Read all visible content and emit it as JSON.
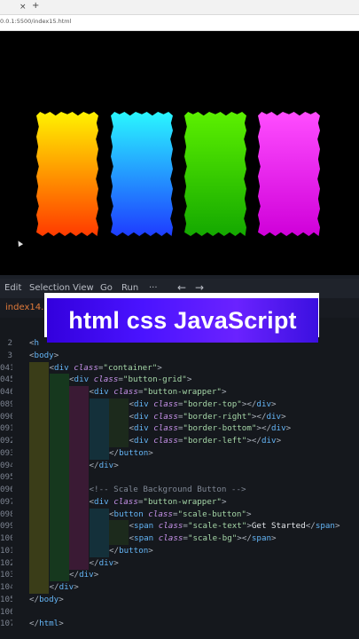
{
  "browser": {
    "tab_close": "×",
    "tab_new": "+",
    "address": "0.0.1:5500/index15.html"
  },
  "preview": {
    "panels": [
      {
        "name": "yellow-orange",
        "from": "#fff200",
        "to": "#ff3a00"
      },
      {
        "name": "cyan-blue",
        "from": "#2af7ff",
        "to": "#1e3cff"
      },
      {
        "name": "green",
        "from": "#5cf000",
        "to": "#14a800"
      },
      {
        "name": "magenta",
        "from": "#ff4dff",
        "to": "#cf00d9"
      }
    ]
  },
  "menu": {
    "items": [
      "Edit",
      "Selection",
      "View",
      "Go",
      "Run",
      "···"
    ],
    "back": "←",
    "forward": "→"
  },
  "editor": {
    "active_tab": "index14.h",
    "lines": [
      {
        "n": "2",
        "guides": 0,
        "tokens": [
          [
            "p",
            "<"
          ],
          [
            "t",
            "h"
          ]
        ]
      },
      {
        "n": "3",
        "guides": 0,
        "tokens": [
          [
            "p",
            "<"
          ],
          [
            "t",
            "body"
          ],
          [
            "p",
            ">"
          ]
        ]
      },
      {
        "n": "041",
        "guides": 1,
        "tokens": [
          [
            "p",
            "<"
          ],
          [
            "t",
            "div"
          ],
          [
            "x",
            " "
          ],
          [
            "a",
            "class"
          ],
          [
            "p",
            "="
          ],
          [
            "s",
            "\"container\""
          ],
          [
            "p",
            ">"
          ]
        ]
      },
      {
        "n": "045",
        "guides": 2,
        "tokens": [
          [
            "p",
            "<"
          ],
          [
            "t",
            "div"
          ],
          [
            "x",
            " "
          ],
          [
            "a",
            "class"
          ],
          [
            "p",
            "="
          ],
          [
            "s",
            "\"button-grid\""
          ],
          [
            "p",
            ">"
          ]
        ]
      },
      {
        "n": "046",
        "guides": 3,
        "tokens": [
          [
            "p",
            "<"
          ],
          [
            "t",
            "div"
          ],
          [
            "x",
            " "
          ],
          [
            "a",
            "class"
          ],
          [
            "p",
            "="
          ],
          [
            "s",
            "\"button-wrapper\""
          ],
          [
            "p",
            ">"
          ]
        ]
      },
      {
        "n": "089",
        "guides": 5,
        "tokens": [
          [
            "p",
            "<"
          ],
          [
            "t",
            "div"
          ],
          [
            "x",
            " "
          ],
          [
            "a",
            "class"
          ],
          [
            "p",
            "="
          ],
          [
            "s",
            "\"border-top\""
          ],
          [
            "p",
            "></"
          ],
          [
            "t",
            "div"
          ],
          [
            "p",
            ">"
          ]
        ]
      },
      {
        "n": "090",
        "guides": 5,
        "tokens": [
          [
            "p",
            "<"
          ],
          [
            "t",
            "div"
          ],
          [
            "x",
            " "
          ],
          [
            "a",
            "class"
          ],
          [
            "p",
            "="
          ],
          [
            "s",
            "\"border-right\""
          ],
          [
            "p",
            "></"
          ],
          [
            "t",
            "div"
          ],
          [
            "p",
            ">"
          ]
        ]
      },
      {
        "n": "091",
        "guides": 5,
        "tokens": [
          [
            "p",
            "<"
          ],
          [
            "t",
            "div"
          ],
          [
            "x",
            " "
          ],
          [
            "a",
            "class"
          ],
          [
            "p",
            "="
          ],
          [
            "s",
            "\"border-bottom\""
          ],
          [
            "p",
            "></"
          ],
          [
            "t",
            "div"
          ],
          [
            "p",
            ">"
          ]
        ]
      },
      {
        "n": "092",
        "guides": 5,
        "tokens": [
          [
            "p",
            "<"
          ],
          [
            "t",
            "div"
          ],
          [
            "x",
            " "
          ],
          [
            "a",
            "class"
          ],
          [
            "p",
            "="
          ],
          [
            "s",
            "\"border-left\""
          ],
          [
            "p",
            "></"
          ],
          [
            "t",
            "div"
          ],
          [
            "p",
            ">"
          ]
        ]
      },
      {
        "n": "093",
        "guides": 4,
        "tokens": [
          [
            "p",
            "</"
          ],
          [
            "t",
            "button"
          ],
          [
            "p",
            ">"
          ]
        ]
      },
      {
        "n": "094",
        "guides": 3,
        "tokens": [
          [
            "p",
            "</"
          ],
          [
            "t",
            "div"
          ],
          [
            "p",
            ">"
          ]
        ]
      },
      {
        "n": "095",
        "guides": 3,
        "tokens": []
      },
      {
        "n": "096",
        "guides": 3,
        "tokens": [
          [
            "c",
            "<!-- Scale Background Button -->"
          ]
        ]
      },
      {
        "n": "097",
        "guides": 3,
        "tokens": [
          [
            "p",
            "<"
          ],
          [
            "t",
            "div"
          ],
          [
            "x",
            " "
          ],
          [
            "a",
            "class"
          ],
          [
            "p",
            "="
          ],
          [
            "s",
            "\"button-wrapper\""
          ],
          [
            "p",
            ">"
          ]
        ]
      },
      {
        "n": "098",
        "guides": 4,
        "tokens": [
          [
            "p",
            "<"
          ],
          [
            "t",
            "button"
          ],
          [
            "x",
            " "
          ],
          [
            "a",
            "class"
          ],
          [
            "p",
            "="
          ],
          [
            "s",
            "\"scale-button\""
          ],
          [
            "p",
            ">"
          ]
        ]
      },
      {
        "n": "099",
        "guides": 5,
        "tokens": [
          [
            "p",
            "<"
          ],
          [
            "t",
            "span"
          ],
          [
            "x",
            " "
          ],
          [
            "a",
            "class"
          ],
          [
            "p",
            "="
          ],
          [
            "s",
            "\"scale-text\""
          ],
          [
            "p",
            ">"
          ],
          [
            "x",
            "Get Started"
          ],
          [
            "p",
            "</"
          ],
          [
            "t",
            "span"
          ],
          [
            "p",
            ">"
          ]
        ]
      },
      {
        "n": "100",
        "guides": 5,
        "tokens": [
          [
            "p",
            "<"
          ],
          [
            "t",
            "span"
          ],
          [
            "x",
            " "
          ],
          [
            "a",
            "class"
          ],
          [
            "p",
            "="
          ],
          [
            "s",
            "\"scale-bg\""
          ],
          [
            "p",
            "></"
          ],
          [
            "t",
            "span"
          ],
          [
            "p",
            ">"
          ]
        ]
      },
      {
        "n": "101",
        "guides": 4,
        "tokens": [
          [
            "p",
            "</"
          ],
          [
            "t",
            "button"
          ],
          [
            "p",
            ">"
          ]
        ]
      },
      {
        "n": "102",
        "guides": 3,
        "tokens": [
          [
            "p",
            "</"
          ],
          [
            "t",
            "div"
          ],
          [
            "p",
            ">"
          ]
        ]
      },
      {
        "n": "103",
        "guides": 2,
        "tokens": [
          [
            "p",
            "</"
          ],
          [
            "t",
            "div"
          ],
          [
            "p",
            ">"
          ]
        ]
      },
      {
        "n": "104",
        "guides": 1,
        "tokens": [
          [
            "p",
            "</"
          ],
          [
            "t",
            "div"
          ],
          [
            "p",
            ">"
          ]
        ]
      },
      {
        "n": "105",
        "guides": 0,
        "tokens": [
          [
            "p",
            "</"
          ],
          [
            "t",
            "body"
          ],
          [
            "p",
            ">"
          ]
        ]
      },
      {
        "n": "106",
        "guides": 0,
        "tokens": []
      },
      {
        "n": "107",
        "guides": 0,
        "tokens": [
          [
            "p",
            "</"
          ],
          [
            "t",
            "html"
          ],
          [
            "p",
            ">"
          ]
        ]
      }
    ]
  },
  "banner": {
    "text": "html css JavaScript"
  },
  "colors": {
    "guide_palette": [
      "#3a3d18",
      "#16381e",
      "#3a1a34",
      "#14303a",
      "#1c2a1c"
    ]
  }
}
